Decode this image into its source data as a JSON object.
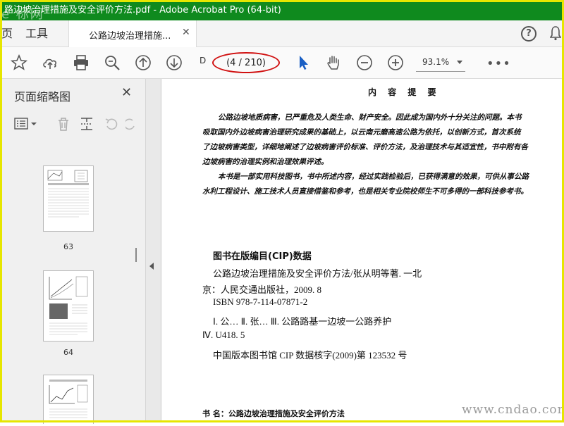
{
  "titlebar": {
    "title": "路边坡治理措施及安全评价方法.pdf - Adobe Acrobat Pro (64-bit)",
    "watermark": "e 标网"
  },
  "tabs": {
    "left_edge": "页",
    "tools": "工具",
    "document": "公路边坡治理措施...",
    "close": "✕",
    "help": "?"
  },
  "toolbar": {
    "page_prefix": "D",
    "page_indicator": "(4 / 210)",
    "zoom": "93.1%",
    "more": "•••"
  },
  "sidebar": {
    "title": "页面缩略图",
    "close": "✕",
    "thumbnails": [
      {
        "label": "63"
      },
      {
        "label": "64"
      },
      {
        "label": ""
      }
    ]
  },
  "document": {
    "intro_title": "内 容 提 要",
    "intro_lines": [
      "公路边坡地质病害，已严重危及人类生命、财产安全。因此成为国内外十分关注的问题。本书",
      "吸取国内外边坡病害治理研究成果的基础上，以云南元磨高速公路为依托，以创新方式，首次系统",
      "了边坡病害类型，详细地阐述了边坡病害评价标准、评价方法，及治理技术与其适宜性，书中附有各",
      "边坡病害的治理实例和治理效果评述。",
      "本书是一部实用科技图书，书中所述内容，经过实践检验后，已获得满意的效果，可供从事公路",
      "水利工程设计、施工技术人员直接借鉴和参考，也是相关专业院校师生不可多得的一部科技参考书。"
    ],
    "cip_heading": "图书在版编目(CIP)数据",
    "cip_lines": [
      "公路边坡治理措施及安全评价方法/张从明等著. 一北",
      "京：人民交通出版社，2009. 8",
      "ISBN  978-7-114-07871-2",
      "Ⅰ. 公…   Ⅱ. 张…   Ⅲ. 公路路基一边坡一公路养护",
      "Ⅳ. U418. 5",
      "中国版本图书馆 CIP 数据核字(2009)第 123532 号"
    ],
    "footer_label": "书      名：公路边坡治理措施及安全评价方法",
    "watermark": "www.cndao.com"
  },
  "colors": {
    "titlebar": "#0f8a1e",
    "highlight": "#d01010",
    "frame": "#e6e600",
    "accent_cursor": "#1a5fc4"
  }
}
